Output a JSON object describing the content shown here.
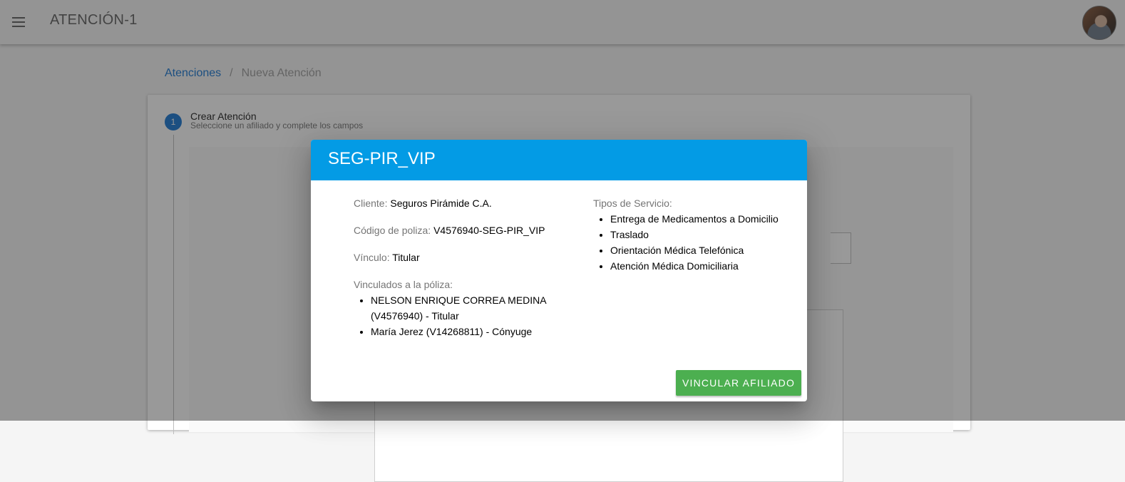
{
  "appbar": {
    "title": "ATENCIÓN-1",
    "menu_icon": "menu-icon"
  },
  "breadcrumb": {
    "link": "Atenciones",
    "separator": "/",
    "current": "Nueva Atención"
  },
  "stepper": {
    "step_number": "1",
    "title": "Crear Atención",
    "subtitle": "Seleccione un afiliado y complete los campos"
  },
  "dialog": {
    "title": "SEG-PIR_VIP",
    "cliente_label": "Cliente:",
    "cliente_value": "Seguros Pirámide C.A.",
    "codigo_label": "Código de poliza:",
    "codigo_value": "V4576940-SEG-PIR_VIP",
    "vinculo_label": "Vínculo:",
    "vinculo_value": "Titular",
    "vinculados_label": "Vinculados a la póliza:",
    "vinculados": [
      "NELSON ENRIQUE CORREA MEDINA (V4576940) - Titular",
      "María Jerez (V14268811) - Cónyuge"
    ],
    "tipos_label": "Tipos de Servicio:",
    "tipos": [
      "Entrega de Medicamentos a Domicilio",
      "Traslado",
      "Orientación Médica Telefónica",
      "Atención Médica Domiciliaria"
    ],
    "action_button": "VINCULAR AFILIADO"
  },
  "colors": {
    "dialog_header": "#039be5",
    "primary": "#1976d2",
    "action": "#4caf50"
  }
}
